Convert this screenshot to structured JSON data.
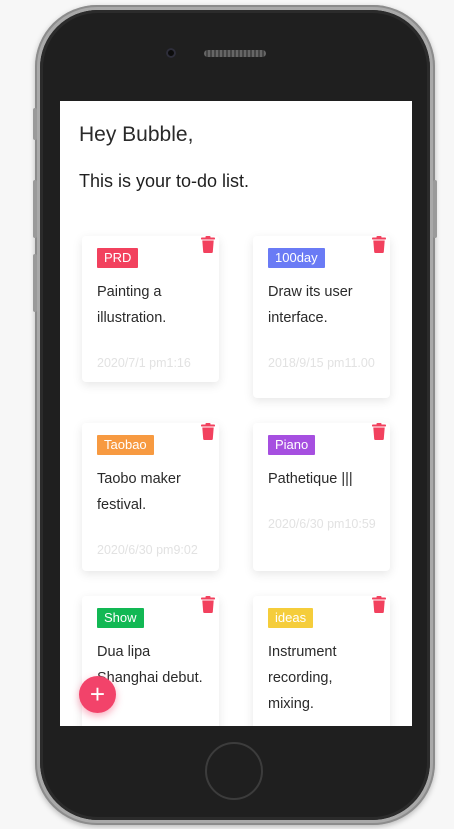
{
  "header": {
    "greeting": "Hey Bubble,",
    "subtitle": "This is your to-do list."
  },
  "todos": [
    {
      "tag": "PRD",
      "tag_color": "#f2415e",
      "text": "Painting a illustration.",
      "date": "2020/7/1 pm1:16"
    },
    {
      "tag": "100day",
      "tag_color": "#6a7bf5",
      "text": "Draw its user interface.",
      "date": "2018/9/15 pm11.00"
    },
    {
      "tag": "Taobao",
      "tag_color": "#f79a41",
      "text": "Taobo maker festival.",
      "date": "2020/6/30 pm9:02"
    },
    {
      "tag": "Piano",
      "tag_color": "#a64fe0",
      "text": "Pathetique |||",
      "date": "2020/6/30 pm10:59"
    },
    {
      "tag": "Show",
      "tag_color": "#12b854",
      "text": "Dua lipa Shanghai debut.",
      "date": ""
    },
    {
      "tag": "ideas",
      "tag_color": "#f5cd3b",
      "text": "Instrument recording, mixing.",
      "date": ""
    }
  ],
  "icons": {
    "delete": "trash-icon",
    "add": "plus-icon"
  },
  "fab": {
    "label": "+"
  },
  "colors": {
    "accent": "#f2436a",
    "trash": "#f2415e",
    "date_text": "#e2e2e2"
  }
}
